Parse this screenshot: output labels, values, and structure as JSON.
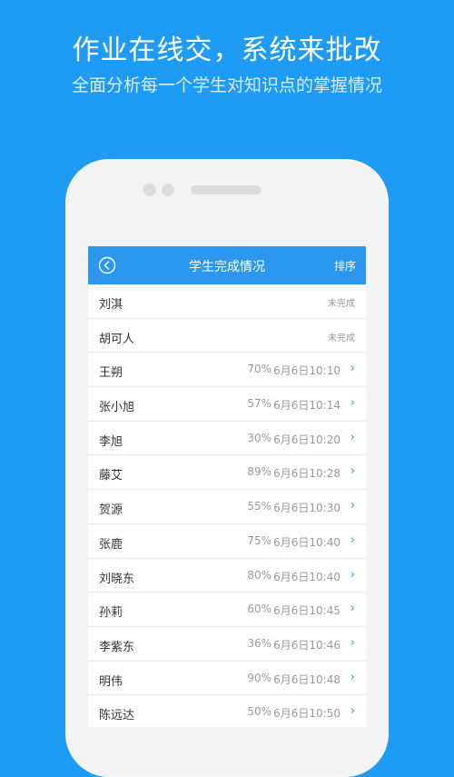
{
  "promo": {
    "headline": "作业在线交，系统来批改",
    "subline": "全面分析每一个学生对知识点的掌握情况"
  },
  "colors": {
    "background": "#1e9bf5",
    "appbar": "#2c97ee",
    "accent": "#2c97ee"
  },
  "appbar": {
    "back_icon": "back-circle-icon",
    "title": "学生完成情况",
    "action": "排序"
  },
  "students": [
    {
      "name": "刘淇",
      "status": "未完成"
    },
    {
      "name": "胡可人",
      "status": "未完成"
    },
    {
      "name": "王朔",
      "pct": "70%",
      "time": "6月6日10:10",
      "chev": "›"
    },
    {
      "name": "张小旭",
      "pct": "57%",
      "time": "6月6日10:14",
      "chev": "›"
    },
    {
      "name": "李旭",
      "pct": "30%",
      "time": "6月6日10:20",
      "chev": "›"
    },
    {
      "name": "藤艾",
      "pct": "89%",
      "time": "6月6日10:28",
      "chev": "›"
    },
    {
      "name": "贺源",
      "pct": "55%",
      "time": "6月6日10:30",
      "chev": "›"
    },
    {
      "name": "张鹿",
      "pct": "75%",
      "time": "6月6日10:40",
      "chev": "›"
    },
    {
      "name": "刘晓东",
      "pct": "80%",
      "time": "6月6日10:40",
      "chev": "›"
    },
    {
      "name": "孙莉",
      "pct": "60%",
      "time": "6月6日10:45",
      "chev": "›"
    },
    {
      "name": "李紫东",
      "pct": "36%",
      "time": "6月6日10:46",
      "chev": "›"
    },
    {
      "name": "明伟",
      "pct": "90%",
      "time": "6月6日10:48",
      "chev": "›"
    },
    {
      "name": "陈远达",
      "pct": "50%",
      "time": "6月6日10:50",
      "chev": "›"
    }
  ]
}
